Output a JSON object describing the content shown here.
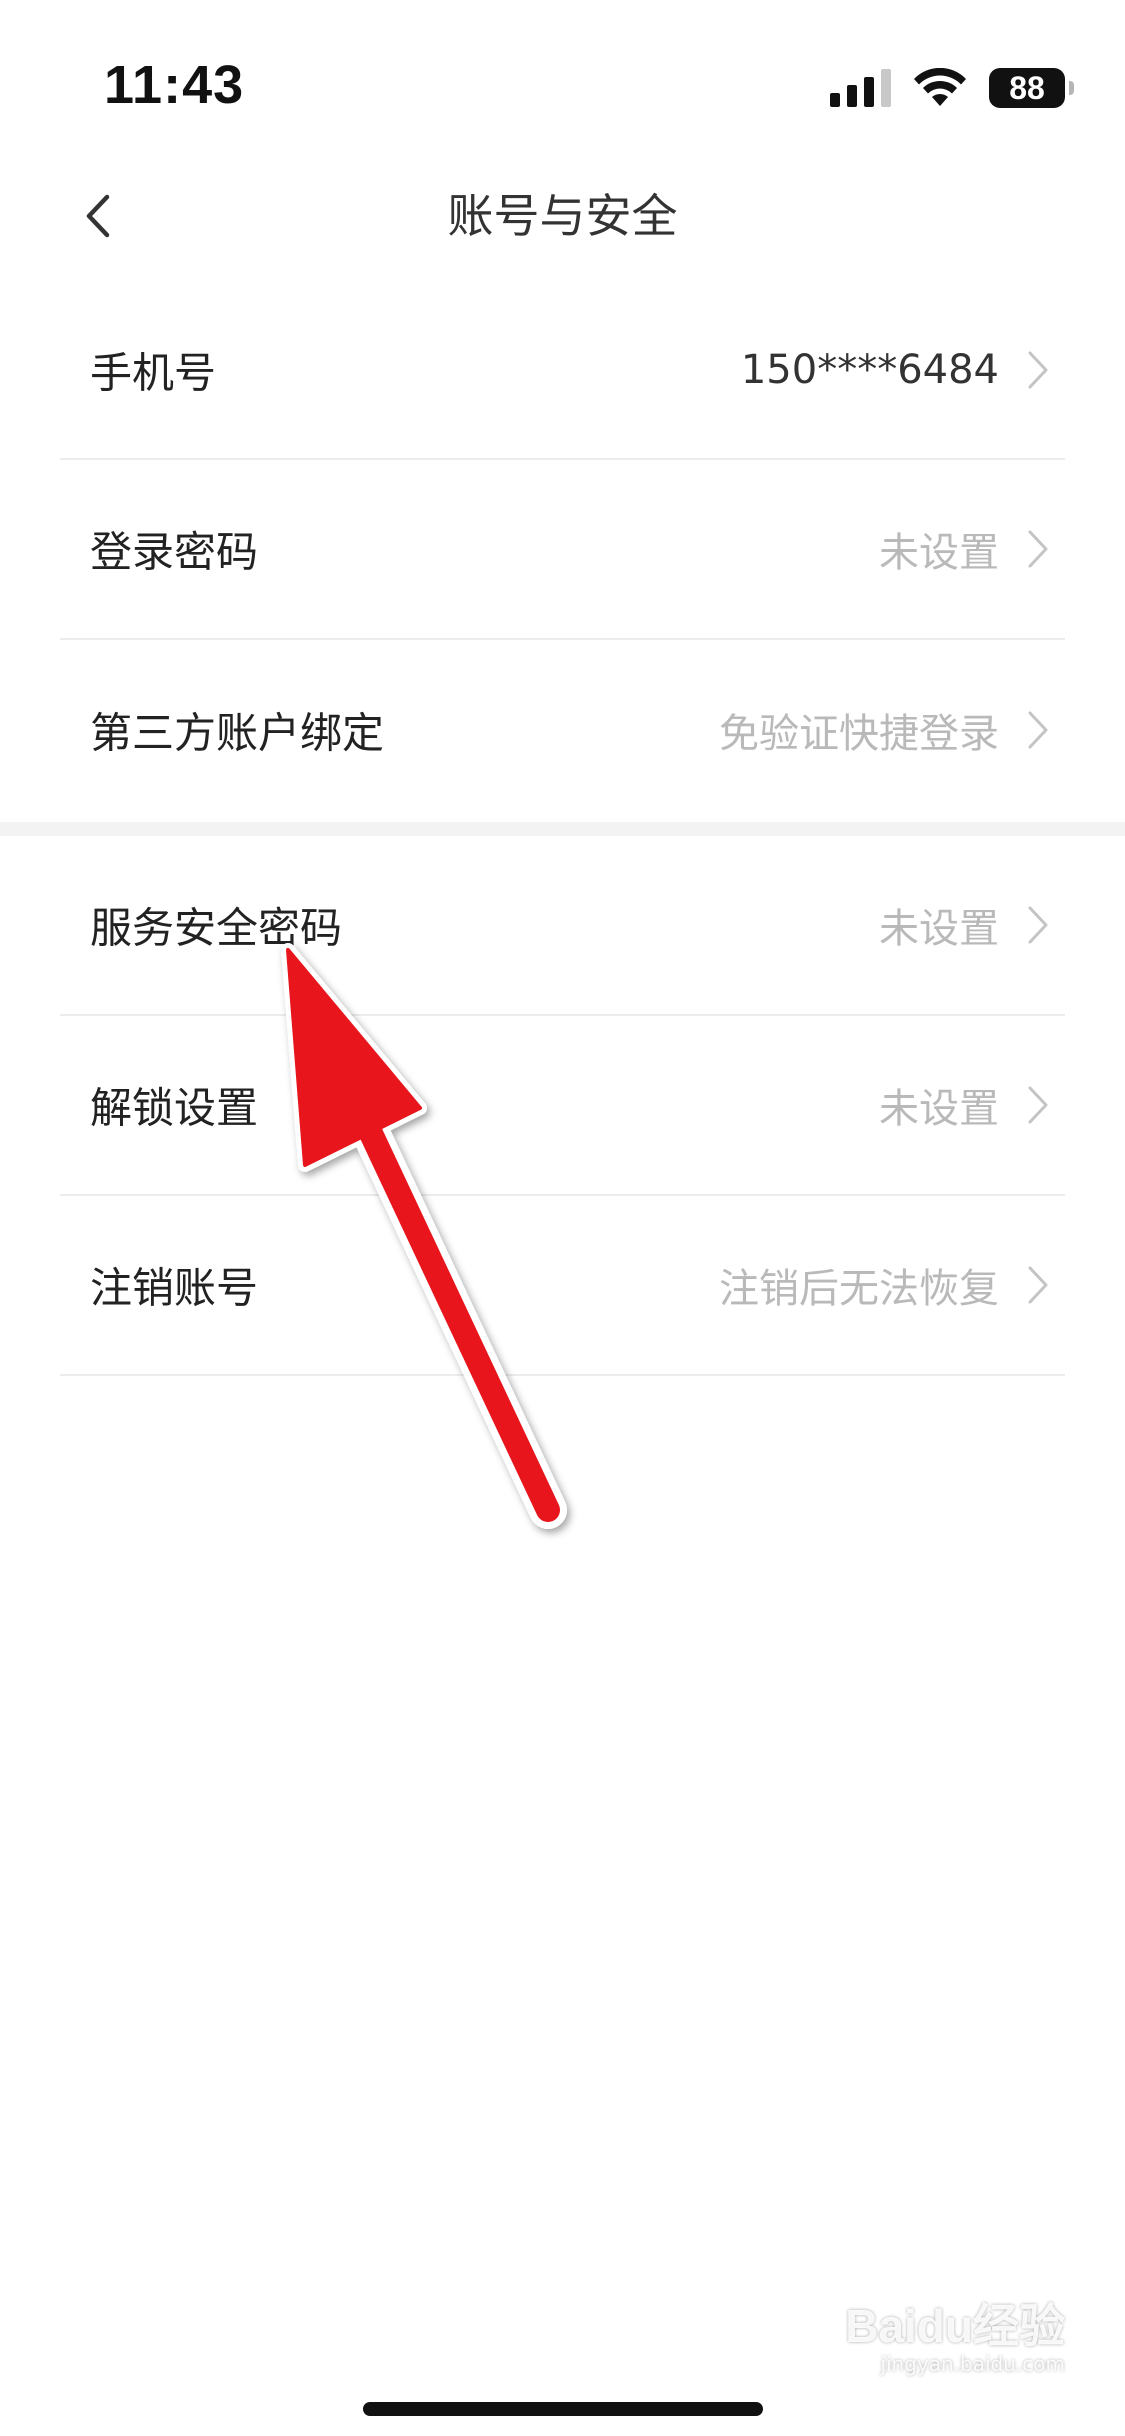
{
  "status_bar": {
    "time": "11:43",
    "battery": "88",
    "icons": [
      "cellular-signal-icon",
      "wifi-icon",
      "battery-icon"
    ]
  },
  "nav": {
    "title": "账号与安全",
    "back_icon": "chevron-left-icon"
  },
  "groups": [
    {
      "items": [
        {
          "label": "手机号",
          "value": "150****6484"
        },
        {
          "label": "登录密码",
          "value": "未设置"
        },
        {
          "label": "第三方账户绑定",
          "value": "免验证快捷登录"
        }
      ]
    },
    {
      "items": [
        {
          "label": "服务安全密码",
          "value": "未设置"
        },
        {
          "label": "解锁设置",
          "value": "未设置"
        },
        {
          "label": "注销账号",
          "value": "注销后无法恢复"
        }
      ]
    }
  ],
  "watermark": {
    "brand": "Baidu经验",
    "url": "jingyan.baidu.com"
  },
  "colors": {
    "value_text": "#b9b9b9",
    "label_text": "#222222",
    "divider": "#ececec",
    "annotation_arrow": "#e8141b"
  }
}
